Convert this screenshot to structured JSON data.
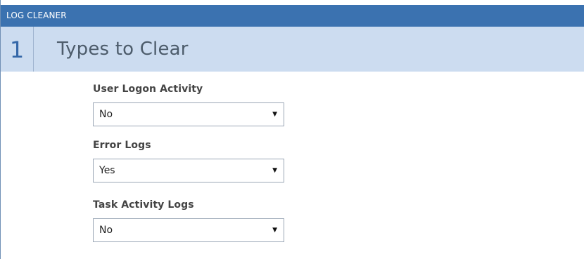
{
  "window": {
    "title": "LOG CLEANER"
  },
  "section": {
    "number": "1",
    "title": "Types to Clear"
  },
  "fields": [
    {
      "label": "User Logon Activity",
      "value": "No"
    },
    {
      "label": "Error Logs",
      "value": "Yes"
    },
    {
      "label": "Task Activity Logs",
      "value": "No"
    }
  ],
  "icons": {
    "dropdown": "chevron-down-icon"
  },
  "colors": {
    "titlebar": "#3b72b0",
    "section_header": "#ccdcf0",
    "section_number": "#3467a8"
  }
}
